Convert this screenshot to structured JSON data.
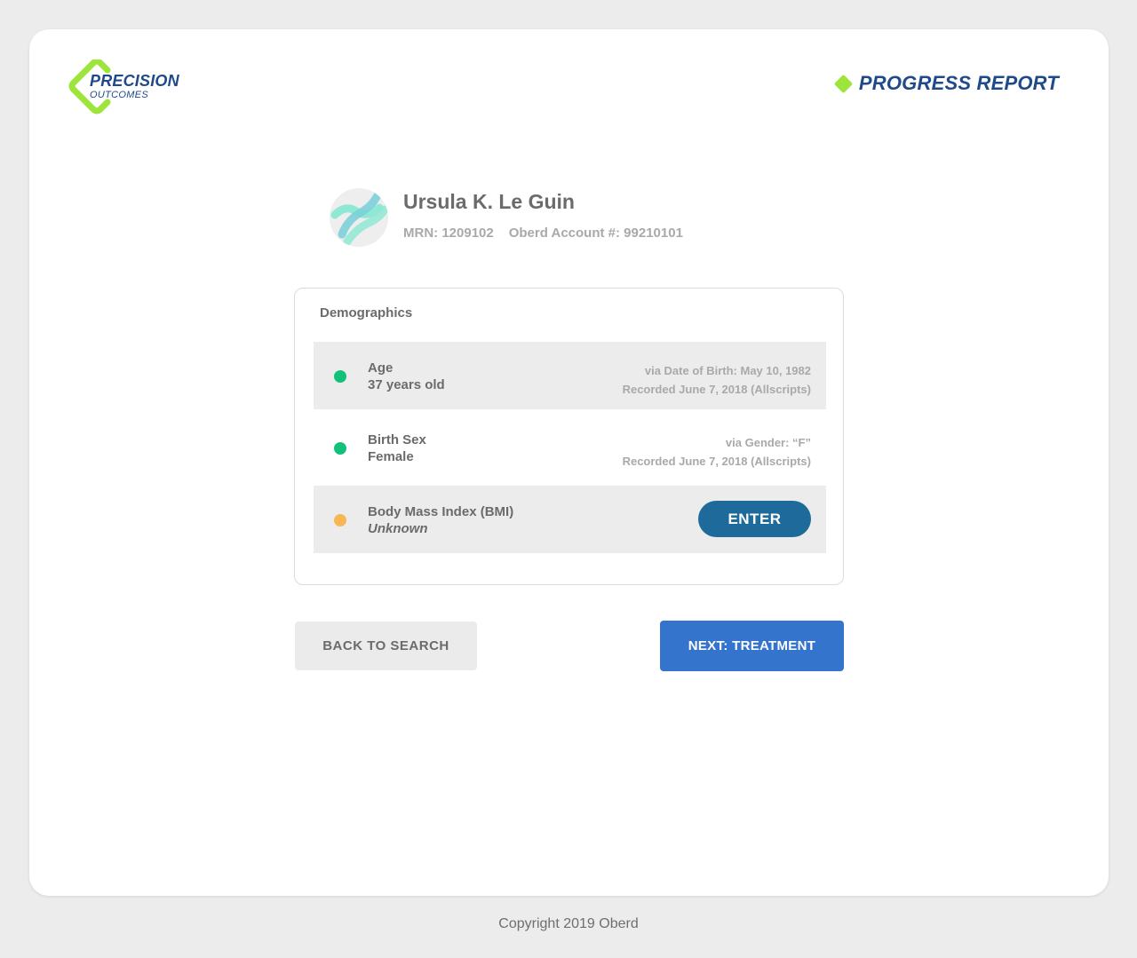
{
  "brand": {
    "logo_line1": "PRECISION",
    "logo_line2": "OUTCOMES",
    "logo_icon": "diamond-outline-icon",
    "logo_color": "#9de43b",
    "brand_color": "#1f4a8a"
  },
  "header": {
    "title": "PROGRESS REPORT",
    "marker_icon": "diamond-icon"
  },
  "patient": {
    "name": "Ursula K. Le Guin",
    "mrn": "MRN: 1209102",
    "account": "Oberd Account #: 99210101",
    "avatar_icon": "avatar-icon"
  },
  "demographics": {
    "title": "Demographics",
    "rows": [
      {
        "label": "Age",
        "value": "37 years old",
        "source_line1": "via Date of Birth: May 10, 1982",
        "source_line2": "Recorded June 7, 2018 (Allscripts)",
        "status_color": "#13c07a"
      },
      {
        "label": "Birth Sex",
        "value": "Female",
        "source_line1": "via Gender: “F”",
        "source_line2": "Recorded June 7, 2018 (Allscripts)",
        "status_color": "#13c07a"
      },
      {
        "label": "Body Mass Index (BMI)",
        "value": "Unknown",
        "action_label": "ENTER",
        "status_color": "#f8b752"
      }
    ]
  },
  "actions": {
    "back_label": "BACK TO SEARCH",
    "next_label": "NEXT: TREATMENT",
    "next_color": "#3474cd",
    "enter_color": "#1e6b9b"
  },
  "footer": {
    "copyright": "Copyright 2019 Oberd"
  }
}
